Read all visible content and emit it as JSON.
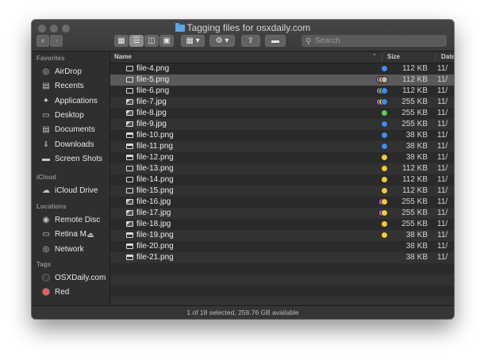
{
  "window": {
    "title": "Tagging files for osxdaily.com",
    "status": "1 of 18 selected, 258.76 GB available"
  },
  "toolbar": {
    "back_icon": "chevron-left-icon",
    "forward_icon": "chevron-right-icon",
    "search_placeholder": "Search"
  },
  "sidebar": {
    "sections": [
      {
        "heading": "Favorites",
        "items": [
          {
            "label": "AirDrop",
            "icon": "airdrop-icon"
          },
          {
            "label": "Recents",
            "icon": "recents-icon"
          },
          {
            "label": "Applications",
            "icon": "applications-icon"
          },
          {
            "label": "Desktop",
            "icon": "desktop-icon"
          },
          {
            "label": "Documents",
            "icon": "documents-icon"
          },
          {
            "label": "Downloads",
            "icon": "downloads-icon"
          },
          {
            "label": "Screen Shots",
            "icon": "folder-icon"
          }
        ]
      },
      {
        "heading": "iCloud",
        "items": [
          {
            "label": "iCloud Drive",
            "icon": "cloud-icon"
          }
        ]
      },
      {
        "heading": "Locations",
        "items": [
          {
            "label": "Remote Disc",
            "icon": "disc-icon"
          },
          {
            "label": "Retina M...",
            "icon": "laptop-icon"
          },
          {
            "label": "Network",
            "icon": "network-icon"
          }
        ]
      },
      {
        "heading": "Tags",
        "items": [
          {
            "label": "OSXDaily.com",
            "color": "#3a3a3b"
          },
          {
            "label": "Red",
            "color": "#f25c5c"
          }
        ]
      }
    ]
  },
  "columns": {
    "name": "Name",
    "size": "Size",
    "date": "Date"
  },
  "tag_colors": {
    "blue": "#3f8ef0",
    "purple": "#b662e0",
    "green": "#5ccc52",
    "yellow": "#f6c83a",
    "gray": "#b8b8b8"
  },
  "files": [
    {
      "name": "file-4.png",
      "type": "png",
      "tags": [
        "blue"
      ],
      "size": "112 KB",
      "date": "11/"
    },
    {
      "name": "file-5.png",
      "type": "png",
      "tags": [
        "purple",
        "yellow",
        "gray"
      ],
      "size": "112 KB",
      "date": "11/",
      "selected": true
    },
    {
      "name": "file-6.png",
      "type": "png",
      "tags": [
        "purple",
        "green",
        "blue"
      ],
      "size": "112 KB",
      "date": "11/"
    },
    {
      "name": "file-7.jpg",
      "type": "jpg",
      "tags": [
        "purple",
        "yellow",
        "blue"
      ],
      "size": "255 KB",
      "date": "11/"
    },
    {
      "name": "file-8.jpg",
      "type": "jpg",
      "tags": [
        "green"
      ],
      "size": "255 KB",
      "date": "11/"
    },
    {
      "name": "file-9.jpg",
      "type": "jpg",
      "tags": [
        "blue"
      ],
      "size": "255 KB",
      "date": "11/"
    },
    {
      "name": "file-10.png",
      "type": "web",
      "tags": [
        "blue"
      ],
      "size": "38 KB",
      "date": "11/"
    },
    {
      "name": "file-11.png",
      "type": "web",
      "tags": [
        "blue"
      ],
      "size": "38 KB",
      "date": "11/"
    },
    {
      "name": "file-12.png",
      "type": "web",
      "tags": [
        "yellow"
      ],
      "size": "38 KB",
      "date": "11/"
    },
    {
      "name": "file-13.png",
      "type": "png",
      "tags": [
        "yellow"
      ],
      "size": "112 KB",
      "date": "11/"
    },
    {
      "name": "file-14.png",
      "type": "png",
      "tags": [
        "yellow"
      ],
      "size": "112 KB",
      "date": "11/"
    },
    {
      "name": "file-15.png",
      "type": "png",
      "tags": [
        "yellow"
      ],
      "size": "112 KB",
      "date": "11/"
    },
    {
      "name": "file-16.jpg",
      "type": "jpg",
      "tags": [
        "purple",
        "yellow"
      ],
      "size": "255 KB",
      "date": "11/"
    },
    {
      "name": "file-17.jpg",
      "type": "jpg",
      "tags": [
        "purple",
        "yellow"
      ],
      "size": "255 KB",
      "date": "11/"
    },
    {
      "name": "file-18.jpg",
      "type": "jpg",
      "tags": [
        "yellow"
      ],
      "size": "255 KB",
      "date": "11/"
    },
    {
      "name": "file-19.png",
      "type": "web",
      "tags": [
        "yellow"
      ],
      "size": "38 KB",
      "date": "11/"
    },
    {
      "name": "file-20.png",
      "type": "web",
      "tags": [],
      "size": "38 KB",
      "date": "11/"
    },
    {
      "name": "file-21.png",
      "type": "web",
      "tags": [],
      "size": "38 KB",
      "date": "11/"
    }
  ]
}
